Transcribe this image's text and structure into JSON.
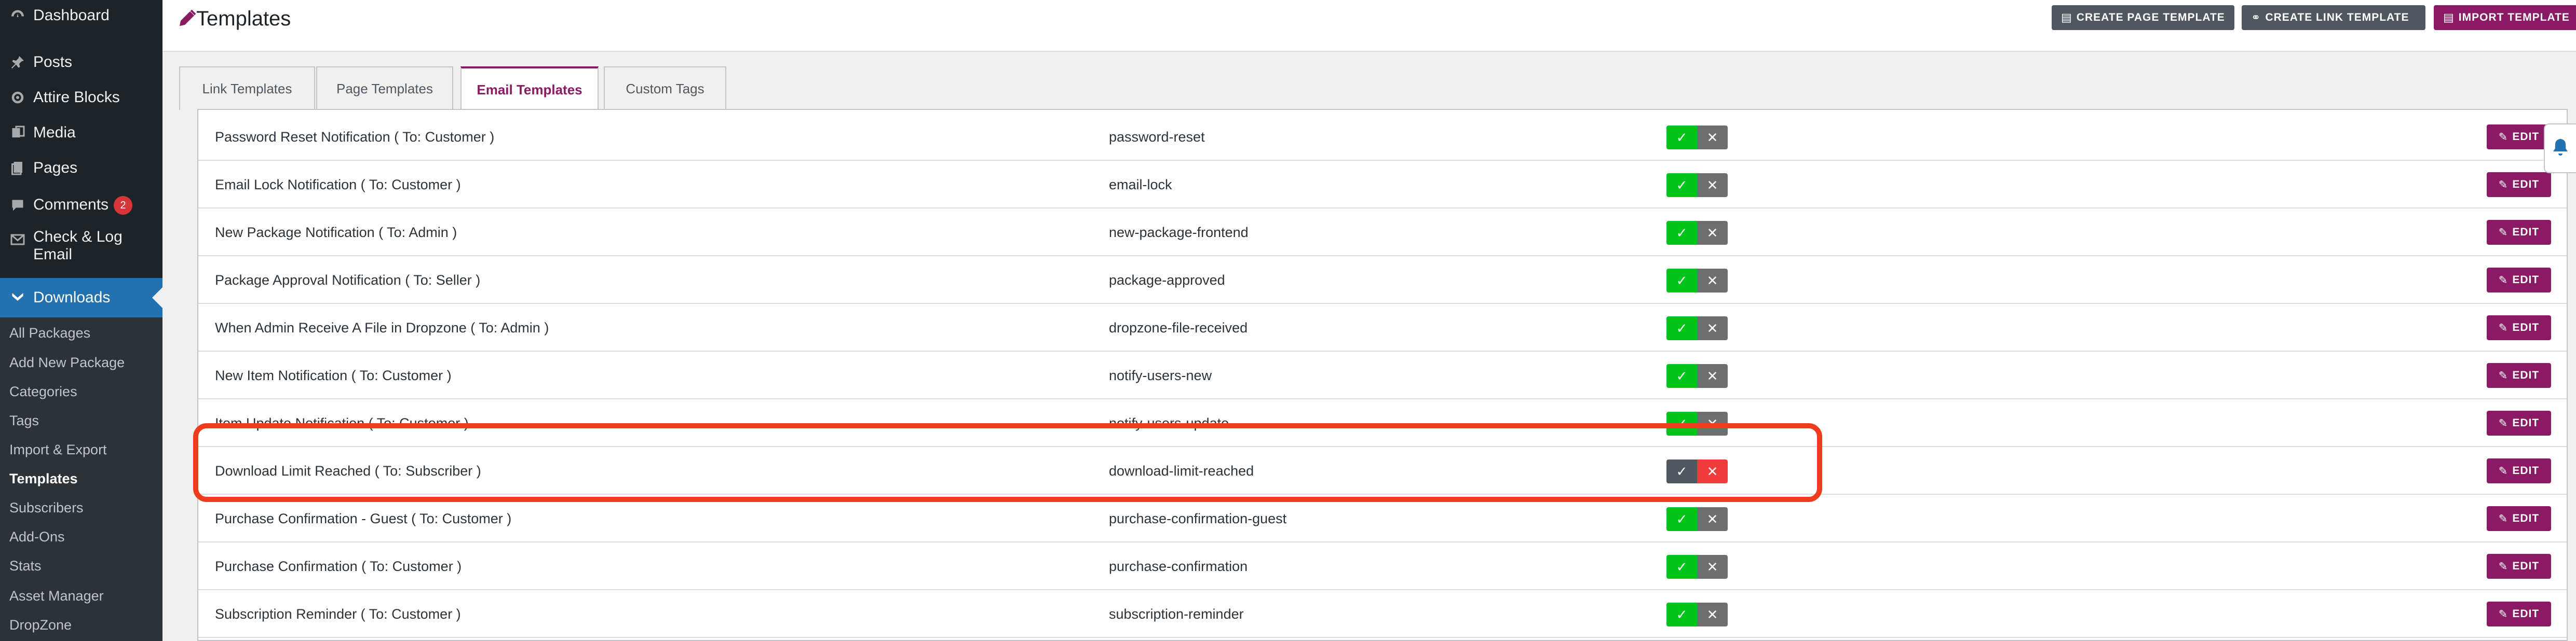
{
  "sidebar": {
    "items": [
      {
        "label": "Dashboard",
        "icon": "dashboard-icon"
      },
      {
        "label": "Posts",
        "icon": "pin-icon"
      },
      {
        "label": "Attire Blocks",
        "icon": "gear-icon"
      },
      {
        "label": "Media",
        "icon": "media-icon"
      },
      {
        "label": "Pages",
        "icon": "pages-icon"
      },
      {
        "label": "Comments",
        "icon": "comment-icon",
        "badge": "2"
      },
      {
        "label": "Check & Log Email",
        "icon": "envelope-icon"
      },
      {
        "label": "Downloads",
        "icon": "download-icon"
      }
    ],
    "submenu": [
      "All Packages",
      "Add New Package",
      "Categories",
      "Tags",
      "Import & Export",
      "Templates",
      "Subscribers",
      "Add-Ons",
      "Stats",
      "Asset Manager",
      "DropZone"
    ]
  },
  "header": {
    "title": "Templates",
    "buttons": {
      "create_page": "CREATE PAGE TEMPLATE",
      "create_link": "CREATE LINK TEMPLATE",
      "import": "IMPORT TEMPLATE"
    }
  },
  "tabs": [
    "Link Templates",
    "Page Templates",
    "Email Templates",
    "Custom Tags"
  ],
  "active_tab": "Email Templates",
  "table": {
    "edit_label": "EDIT",
    "rows": [
      {
        "name": "Password Reset Notification ( To: Customer )",
        "id": "password-reset",
        "enabled": true
      },
      {
        "name": "Email Lock Notification ( To: Customer )",
        "id": "email-lock",
        "enabled": true
      },
      {
        "name": "New Package Notification ( To: Admin )",
        "id": "new-package-frontend",
        "enabled": true
      },
      {
        "name": "Package Approval Notification ( To: Seller )",
        "id": "package-approved",
        "enabled": true
      },
      {
        "name": "When Admin Receive A File in Dropzone ( To: Admin )",
        "id": "dropzone-file-received",
        "enabled": true
      },
      {
        "name": "New Item Notification ( To: Customer )",
        "id": "notify-users-new",
        "enabled": true
      },
      {
        "name": "Item Update Notification ( To: Customer )",
        "id": "notify-users-update",
        "enabled": true
      },
      {
        "name": "Download Limit Reached ( To: Subscriber )",
        "id": "download-limit-reached",
        "enabled": false
      },
      {
        "name": "Purchase Confirmation - Guest ( To: Customer )",
        "id": "purchase-confirmation-guest",
        "enabled": true
      },
      {
        "name": "Purchase Confirmation ( To: Customer )",
        "id": "purchase-confirmation",
        "enabled": true
      },
      {
        "name": "Subscription Reminder ( To: Customer )",
        "id": "subscription-reminder",
        "enabled": true
      }
    ]
  },
  "colors": {
    "accent": "#8a1a64",
    "sidebar": "#1d2327",
    "current": "#2271b1",
    "on": "#00c518",
    "off_red": "#f03c3c",
    "neutral": "#6e6e6e",
    "highlight": "#f03c1e"
  }
}
